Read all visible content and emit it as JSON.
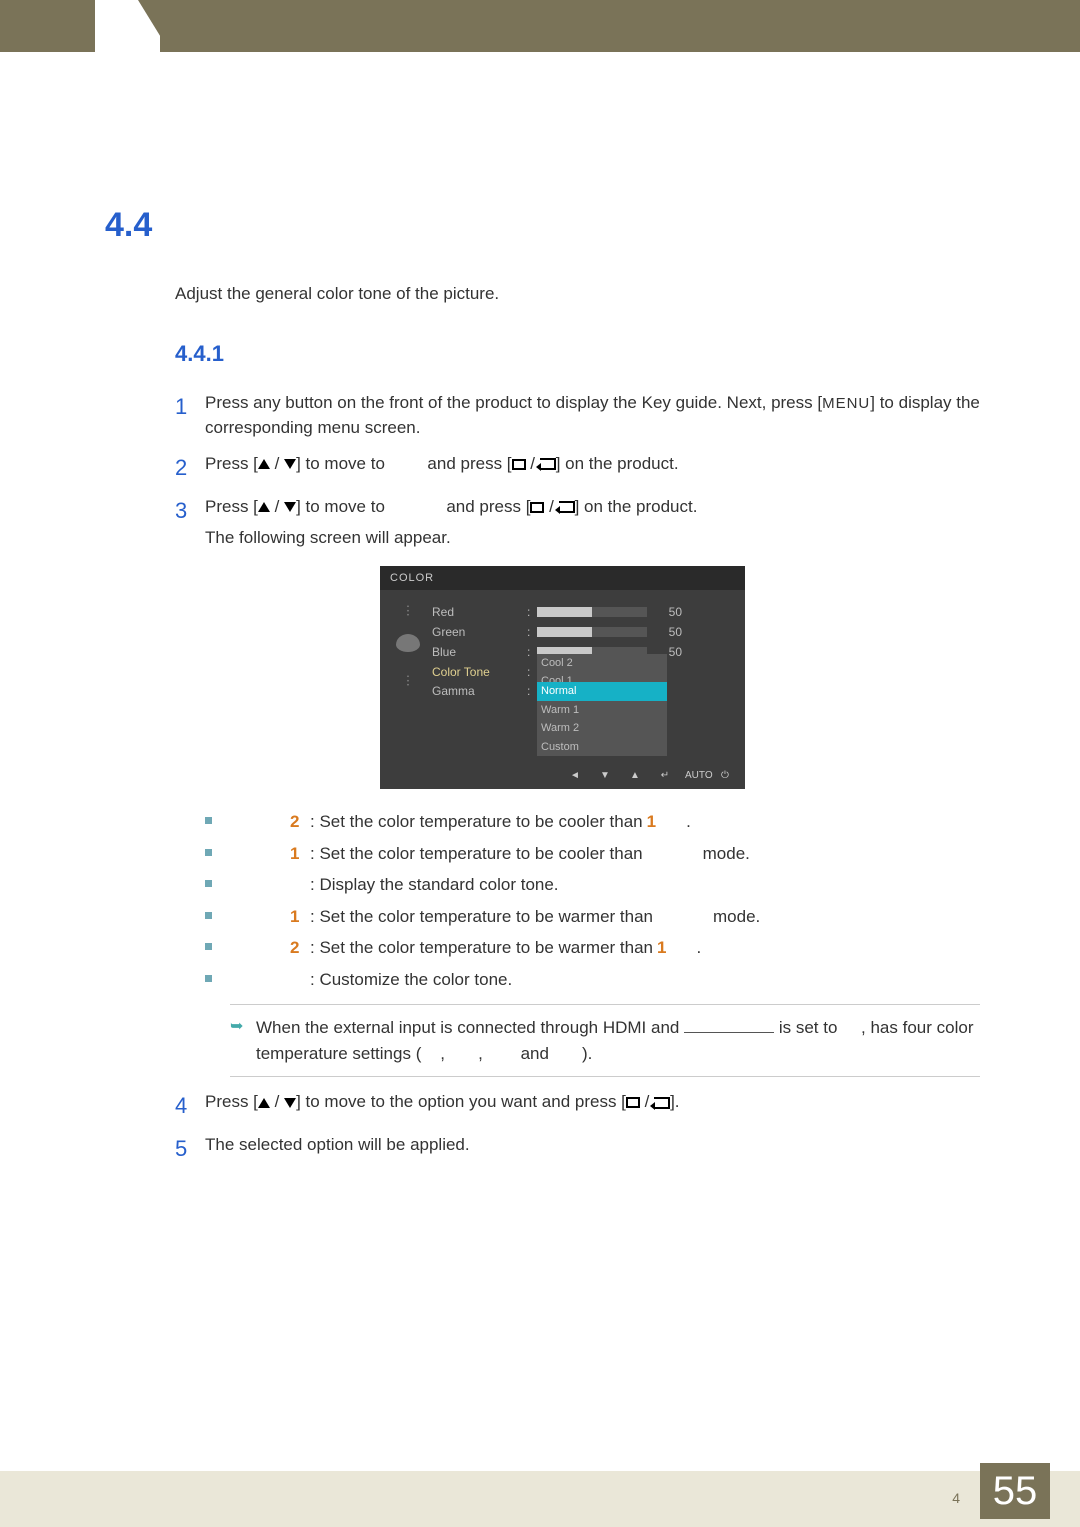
{
  "header": {
    "chapter_small": "4"
  },
  "section": {
    "number": "4.4",
    "intro": "Adjust the general color tone of the picture.",
    "sub_number": "4.4.1"
  },
  "steps": {
    "s1": {
      "num": "1",
      "a": "Press any button on the front of the product to display the Key guide. Next, press [",
      "menu": "MENU",
      "b": "] to display the corresponding menu screen."
    },
    "s2": {
      "num": "2",
      "a": "Press [",
      "b": "] to move to ",
      "c": "and press [",
      "d": "] on the product."
    },
    "s3": {
      "num": "3",
      "a": "Press [",
      "b": "] to move to ",
      "c": "and press [",
      "d": "] on the product.",
      "e": "The following screen will appear."
    },
    "s4": {
      "num": "4",
      "a": "Press [",
      "b": "] to move to the option you want and press [",
      "c": "]."
    },
    "s5": {
      "num": "5",
      "a": "The selected option will be applied."
    }
  },
  "osd": {
    "title": "COLOR",
    "rows": [
      {
        "label": "Red",
        "val": "50"
      },
      {
        "label": "Green",
        "val": "50"
      },
      {
        "label": "Blue",
        "val": "50"
      }
    ],
    "tone_label": "Color Tone",
    "gamma_label": "Gamma",
    "options": [
      "Cool 2",
      "Cool 1",
      "Normal",
      "Warm 1",
      "Warm 2",
      "Custom"
    ],
    "footer": [
      "◄",
      "▼",
      "▲",
      "↵",
      "AUTO",
      "⏻"
    ]
  },
  "bullets": {
    "b1": {
      "n": "2",
      "t": ": Set the color temperature to be cooler than",
      "tail": "1",
      "end": "."
    },
    "b2": {
      "n": "1",
      "t": ": Set the color temperature to be cooler than ",
      "tail": "",
      "end": "mode."
    },
    "b3": {
      "n": "",
      "t": ": Display the standard color tone."
    },
    "b4": {
      "n": "1",
      "t": ": Set the color temperature to be warmer than ",
      "tail": "",
      "end": "mode."
    },
    "b5": {
      "n": "2",
      "t": ": Set the color temperature to be warmer than",
      "tail": "1",
      "end": "."
    },
    "b6": {
      "n": "",
      "t": ": Customize the color tone."
    }
  },
  "note": {
    "a": "When the external input is connected through HDMI and ",
    "b": " is set to ",
    "c": ", has four color temperature settings (",
    "d": ",",
    "e": ",",
    "f": " and ",
    "g": ")."
  },
  "footer": {
    "note": "4",
    "page": "55"
  }
}
